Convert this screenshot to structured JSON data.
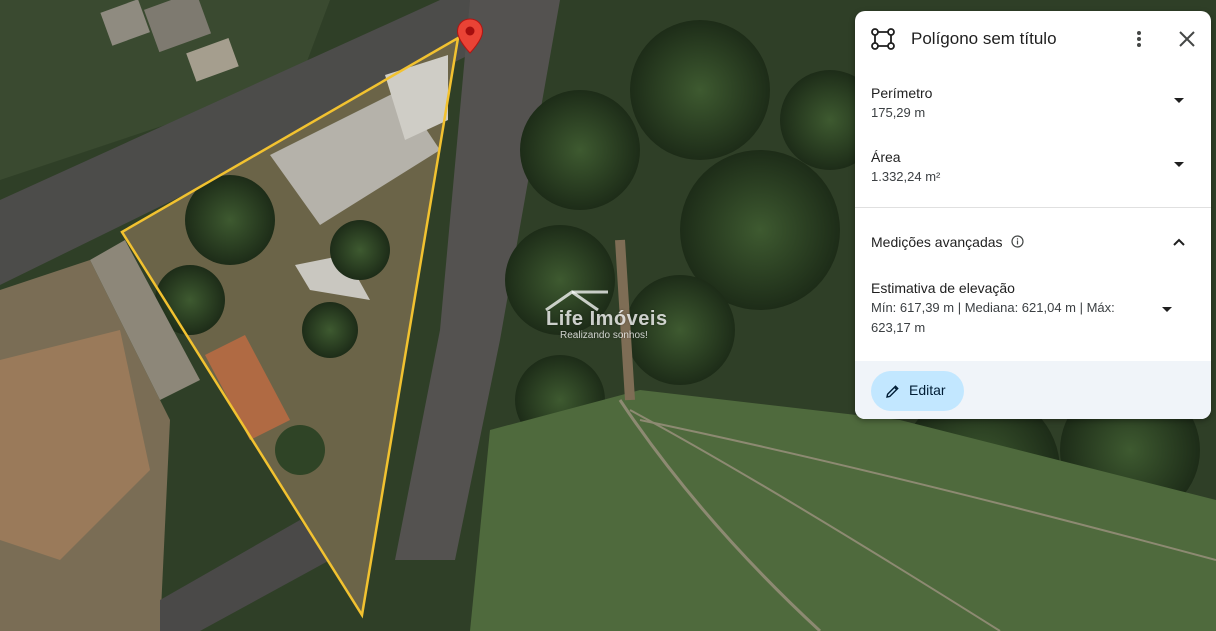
{
  "panel": {
    "title": "Polígono sem título",
    "perimeter": {
      "label": "Perímetro",
      "value": "175,29 m"
    },
    "area": {
      "label": "Área",
      "value": "1.332,24 m²"
    },
    "advanced": {
      "label": "Medições avançadas"
    },
    "elevation": {
      "label": "Estimativa de elevação",
      "line1": "Mín: 617,39 m | Mediana: 621,04 m | Máx:",
      "line2": "623,17 m"
    },
    "edit_label": "Editar"
  },
  "watermark": {
    "brand": "Life Imóveis",
    "tagline": "Realizando sonhos!"
  },
  "colors": {
    "polygon_outline": "#f2c230",
    "pin": "#ea4335",
    "edit_button": "#c2e7ff",
    "panel_footer": "#f0f4f9"
  },
  "icons": {
    "polygon": "polygon-icon",
    "more": "more-vert-icon",
    "close": "close-icon",
    "expand": "chevron-down-icon",
    "collapse": "chevron-up-icon",
    "info": "info-icon",
    "edit": "pencil-icon",
    "pin": "map-pin-icon"
  }
}
